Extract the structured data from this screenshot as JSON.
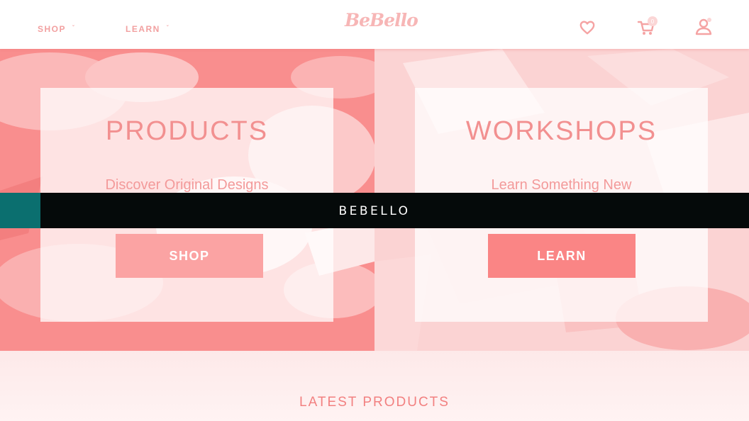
{
  "header": {
    "nav": [
      {
        "label": "SHOP"
      },
      {
        "label": "LEARN"
      }
    ],
    "logo": "BeBello",
    "icons": [
      "heart-icon",
      "cart-icon",
      "user-icon"
    ],
    "cart_count": "0"
  },
  "hero": {
    "left": {
      "title": "PRODUCTS",
      "tagline": "Discover Original Designs",
      "button_label": "SHOP"
    },
    "right": {
      "title": "WORKSHOPS",
      "tagline": "Learn Something New",
      "button_label": "LEARN"
    }
  },
  "banner": {
    "text": "BEBELLO"
  },
  "latest": {
    "title": "LATEST PRODUCTS"
  },
  "colors": {
    "accent": "#f98e8e",
    "accent_light": "#fbd3d3",
    "banner": "#050a0a",
    "banner_edge": "#0b6f6f"
  }
}
